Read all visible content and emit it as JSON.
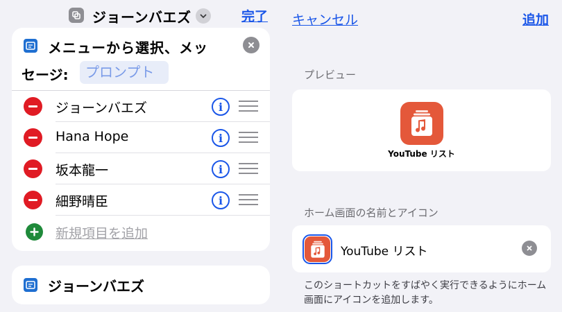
{
  "left": {
    "topbar": {
      "title": "ジョーンバエズ",
      "done_label": "完了"
    },
    "menu_card": {
      "message_line1": "メニューから選択、メッ",
      "message_line2": "セージ:",
      "prompt_placeholder": "プロンプト",
      "items": [
        {
          "label": "ジョーンバエズ"
        },
        {
          "label": "Hana Hope"
        },
        {
          "label": "坂本龍一"
        },
        {
          "label": "細野晴臣"
        }
      ],
      "add_item_label": "新規項目を追加"
    },
    "second_card": {
      "title": "ジョーンバエズ"
    }
  },
  "right": {
    "cancel_label": "キャンセル",
    "add_label": "追加",
    "preview_section_label": "プレビュー",
    "preview_name": "YouTube リスト",
    "home_section_label": "ホーム画面の名前とアイコン",
    "home_name": "YouTube リスト",
    "footnote": "このショートカットをすばやく実行できるようにホーム画面にアイコンを追加します。"
  },
  "icons": {
    "app": "layers-icon",
    "shortcut": "shortcut-icon",
    "app_music": "music-list-icon",
    "colors": {
      "accent": "#1a56e8",
      "delete": "#e01b24",
      "add": "#1f8a3a",
      "app_icon": "#e4583a"
    }
  }
}
